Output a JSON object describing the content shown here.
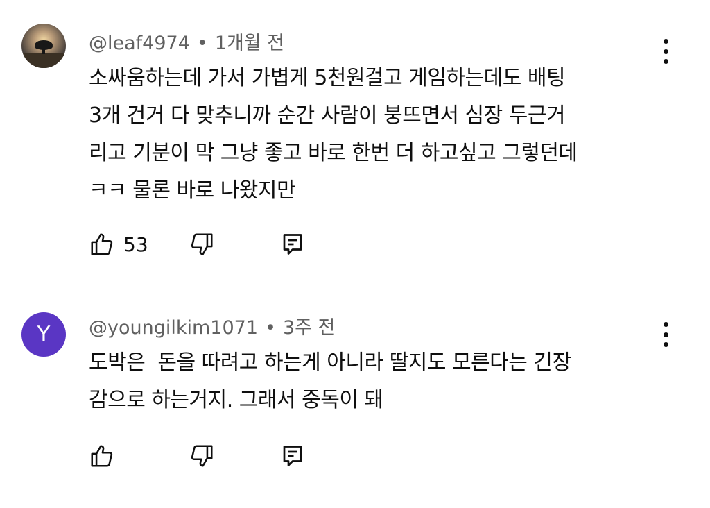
{
  "comments": [
    {
      "author": "@leaf4974",
      "separator": "•",
      "time": "1개월 전",
      "avatar_icon": "tree-sunset-photo",
      "lines": [
        "소싸움하는데 가서 가볍게 5천원걸고 게임하는데도 배팅",
        "3개 건거 다 맞추니까 순간 사람이 붕뜨면서 심장 두근거",
        "리고 기분이 막 그냥 좋고 바로 한번 더 하고싶고 그렇던데",
        "ㅋㅋ 물론 바로 나왔지만"
      ],
      "likes": "53"
    },
    {
      "author": "@youngilkim1071",
      "separator": "•",
      "time": "3주 전",
      "avatar_letter": "Y",
      "avatar_color": "#5a36c4",
      "lines": [
        "도박은  돈을 따려고 하는게 아니라 딸지도 모른다는 긴장",
        "감으로 하는거지. 그래서 중독이 돼"
      ],
      "likes": ""
    }
  ],
  "icons": {
    "like": "thumbs-up-icon",
    "dislike": "thumbs-down-icon",
    "reply": "comment-reply-icon",
    "menu": "more-vert-icon"
  }
}
